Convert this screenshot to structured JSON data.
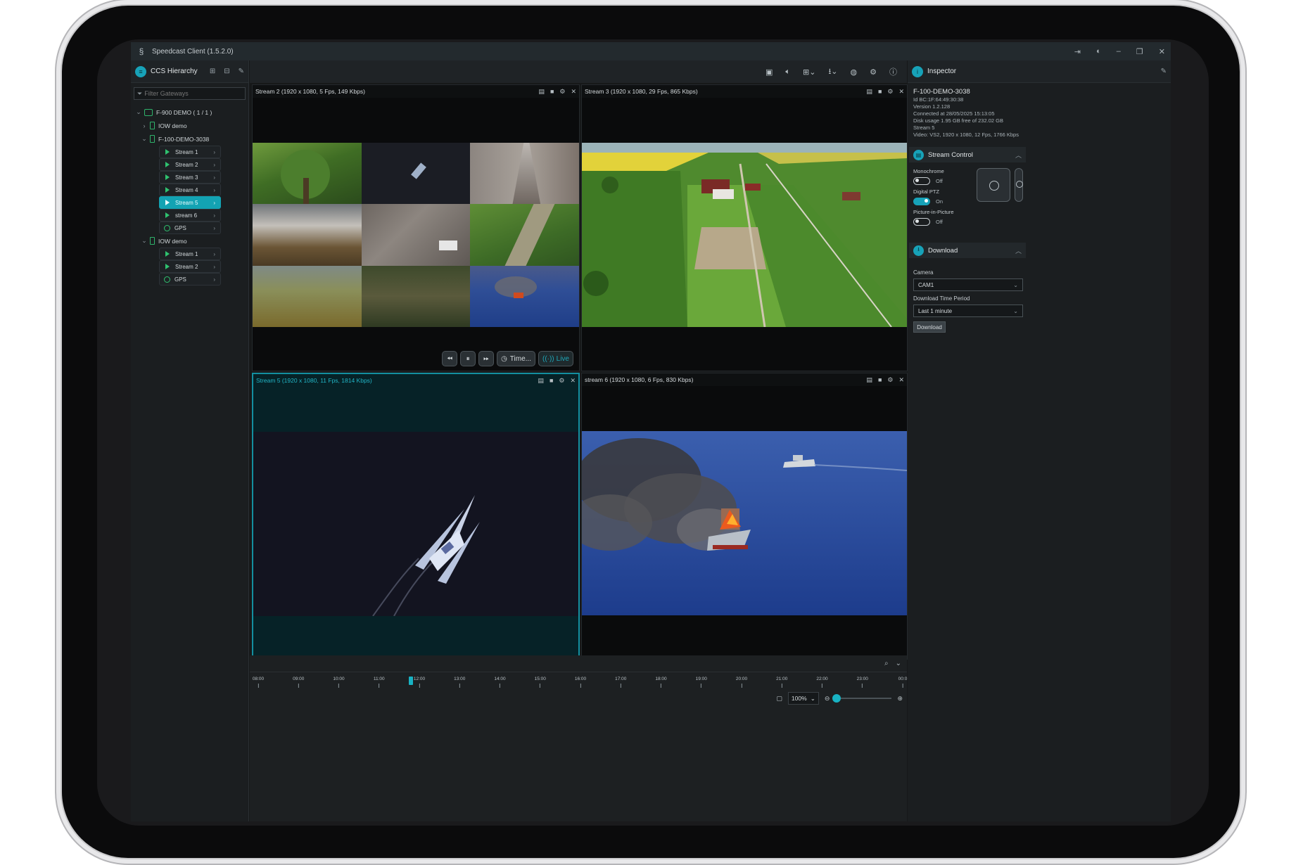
{
  "window": {
    "title": "Speedcast Client (1.5.2.0)"
  },
  "hierarchy": {
    "title": "CCS Hierarchy",
    "filter_placeholder": "Filter Gateways",
    "root_label": "F-900 DEMO  ( 1 / 1 )",
    "items": [
      {
        "label": "IOW demo",
        "level": 1,
        "type": "gateway",
        "expanded": false
      },
      {
        "label": "F-100-DEMO-3038",
        "level": 1,
        "type": "gateway",
        "expanded": true,
        "children": [
          {
            "label": "Stream 1",
            "type": "stream"
          },
          {
            "label": "Stream 2",
            "type": "stream"
          },
          {
            "label": "Stream 3",
            "type": "stream"
          },
          {
            "label": "Stream 4",
            "type": "stream"
          },
          {
            "label": "Stream 5",
            "type": "stream",
            "selected": true
          },
          {
            "label": "stream 6",
            "type": "stream"
          },
          {
            "label": "GPS",
            "type": "gps"
          }
        ]
      },
      {
        "label": "IOW demo",
        "level": 1,
        "type": "gateway",
        "expanded": true,
        "children": [
          {
            "label": "Stream 1",
            "type": "stream"
          },
          {
            "label": "Stream 2",
            "type": "stream"
          },
          {
            "label": "GPS",
            "type": "gps"
          }
        ]
      }
    ]
  },
  "tiles": [
    {
      "title": "Stream 2 (1920 x 1080, 5 Fps, 149 Kbps)"
    },
    {
      "title": "Stream 3 (1920 x 1080, 29 Fps, 865 Kbps)"
    },
    {
      "title": "Stream 5 (1920 x 1080, 11 Fps, 1814 Kbps)",
      "active": true
    },
    {
      "title": "stream 6 (1920 x 1080, 6 Fps, 830 Kbps)"
    }
  ],
  "playback": {
    "time_label": "Time...",
    "live_label": "Live"
  },
  "timeline": {
    "ticks": [
      "08:00",
      "09:00",
      "10:00",
      "11:00",
      "12:00",
      "13:00",
      "14:00",
      "15:00",
      "16:00",
      "17:00",
      "18:00",
      "19:00",
      "20:00",
      "21:00",
      "22:00",
      "23:00",
      "00:0"
    ],
    "zoom_value": "100%"
  },
  "inspector": {
    "title": "Inspector",
    "device_name": "F-100-DEMO-3038",
    "info": [
      "Id  BC:1F:64:49:30:38",
      "Version  1.2.128",
      "Connected at 28/05/2025 15:13:05",
      "Disk usage 1.95 GB free of 232.02 GB",
      "Stream 5",
      "Video: VS2, 1920 x 1080, 12 Fps, 1766 Kbps"
    ],
    "stream_control": {
      "title": "Stream Control",
      "monochrome_label": "Monochrome",
      "monochrome_state": "Off",
      "ptz_label": "Digital PTZ",
      "ptz_state": "On",
      "pip_label": "Picture-in-Picture",
      "pip_state": "Off"
    },
    "download": {
      "title": "Download",
      "camera_label": "Camera",
      "camera_value": "CAM1",
      "period_label": "Download Time Period",
      "period_value": "Last 1 minute",
      "button_label": "Download"
    }
  }
}
